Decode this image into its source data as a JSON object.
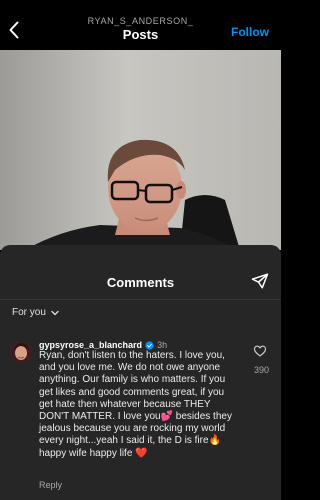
{
  "header": {
    "username": "RYAN_S_ANDERSON_",
    "title": "Posts",
    "follow_label": "Follow",
    "back_icon": "chevron-left-icon"
  },
  "comments_sheet": {
    "title": "Comments",
    "share_icon": "paper-plane-icon",
    "filter_label": "For you",
    "comment": {
      "author": "gypsyrose_a_blanchard",
      "time": "3h",
      "verified": true,
      "text": "Ryan, don't listen to the haters. I love you, and you love me. We do not owe anyone anything. Our family is who matters. If you get likes and good comments great, if you get hate then whatever because THEY DON'T MATTER. I love you💕 besides they jealous because you are rocking my world every night...yeah I said it, the D is fire🔥 happy wife happy life ❤️",
      "like_count": "390",
      "reply_label": "Reply"
    }
  },
  "colors": {
    "accent": "#0095f6",
    "sheet_bg": "#262626",
    "muted_text": "#a8a8a8"
  }
}
